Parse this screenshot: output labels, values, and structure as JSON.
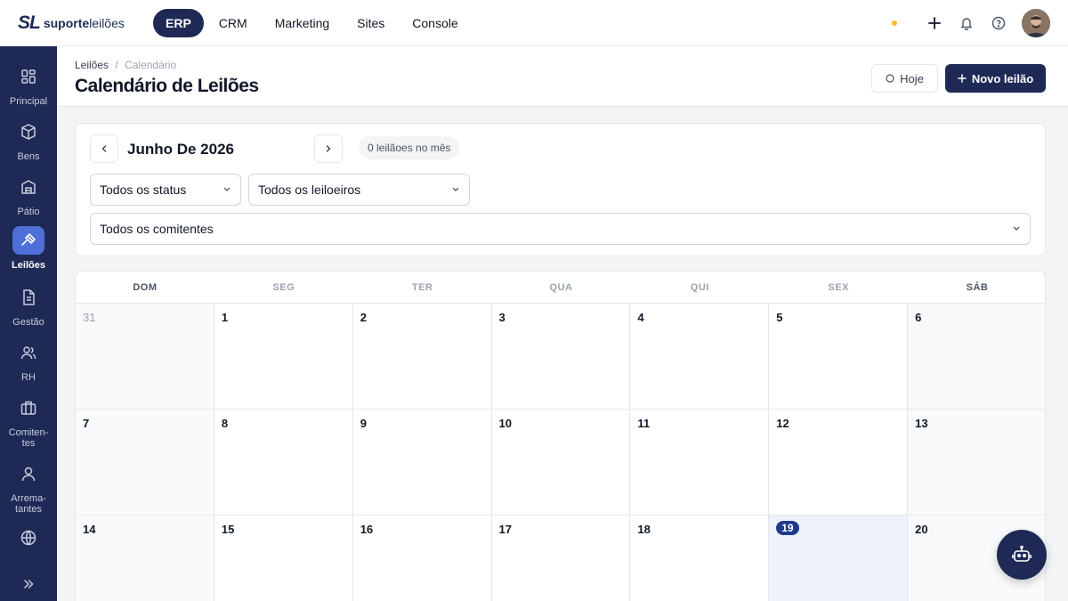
{
  "brand": {
    "mark": "SL",
    "name_bold": "suporte",
    "name_regular": "leilões"
  },
  "nav": [
    "ERP",
    "CRM",
    "Marketing",
    "Sites",
    "Console"
  ],
  "sidebar": [
    {
      "label": "Principal",
      "icon": "grid-icon"
    },
    {
      "label": "Bens",
      "icon": "box-icon"
    },
    {
      "label": "Pátio",
      "icon": "warehouse-icon"
    },
    {
      "label": "Leilões",
      "icon": "gavel-icon",
      "active": true
    },
    {
      "label": "Gestão",
      "icon": "document-icon"
    },
    {
      "label": "RH",
      "icon": "users-icon"
    },
    {
      "label": "Comiten-tes",
      "line1": "Comiten-",
      "line2": "tes",
      "icon": "briefcase-icon"
    },
    {
      "label": "Arrema-tantes",
      "line1": "Arrema-",
      "line2": "tantes",
      "icon": "user-icon"
    },
    {
      "label": "",
      "icon": "globe-icon"
    }
  ],
  "breadcrumb": {
    "item1": "Leilões",
    "sep": "/",
    "item2": "Calendário"
  },
  "page_title": "Calendário de Leilões",
  "buttons": {
    "today": "Hoje",
    "new": "Novo leilão"
  },
  "month": {
    "title": "Junho De 2026",
    "count": "0 leilãoes no mês"
  },
  "filters": {
    "status": "Todos os status",
    "auctioneer": "Todos os leiloeiros",
    "consignor": "Todos os comitentes"
  },
  "weekdays": [
    "DOM",
    "SEG",
    "TER",
    "QUA",
    "QUI",
    "SEX",
    "SÁB"
  ],
  "weeks": [
    [
      "31",
      "1",
      "2",
      "3",
      "4",
      "5",
      "6"
    ],
    [
      "7",
      "8",
      "9",
      "10",
      "11",
      "12",
      "13"
    ],
    [
      "14",
      "15",
      "16",
      "17",
      "18",
      "19",
      "20"
    ]
  ],
  "today": "19",
  "colors": {
    "primary": "#1e2a55",
    "accent": "#4f6fd8",
    "today_bg": "#eef2fb",
    "status_dot": "#fbbf24"
  }
}
